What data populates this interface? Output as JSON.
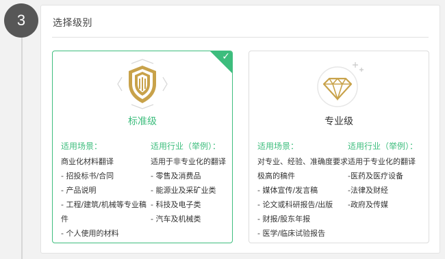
{
  "step": {
    "number": "3"
  },
  "panel": {
    "title": "选择级别"
  },
  "cards": [
    {
      "tier": "标准级",
      "selected": true,
      "icon": "shield-emblem-icon",
      "col1": {
        "heading": "适用场景：",
        "lines": [
          "商业化材料翻译",
          "- 招投标书/合同",
          "- 产品说明",
          "- 工程/建筑/机械等专业稿件",
          "- 个人使用的材料"
        ]
      },
      "col2": {
        "heading": "适用行业（举例）：",
        "lines": [
          "适用于非专业化的翻译",
          "- 零售及消费品",
          "- 能源业及采矿业类",
          "- 科技及电子类",
          "- 汽车及机械类"
        ]
      }
    },
    {
      "tier": "专业级",
      "selected": false,
      "icon": "diamond-icon",
      "col1": {
        "heading": "适用场景：",
        "lines": [
          "对专业、经验、准确度要求极高的稿件",
          "- 媒体宣传/发言稿",
          "- 论文或科研报告/出版",
          "- 财报/股东年报",
          "- 医学/临床试验报告"
        ]
      },
      "col2": {
        "heading": "适用行业（举例）：",
        "lines": [
          "适用于专业化的翻译",
          "-医药及医疗设备",
          "-法律及财经",
          "-政府及传媒"
        ]
      }
    }
  ],
  "colors": {
    "accent": "#3dbd7d",
    "gold": "#c8a24a",
    "step_circle": "#575757"
  }
}
